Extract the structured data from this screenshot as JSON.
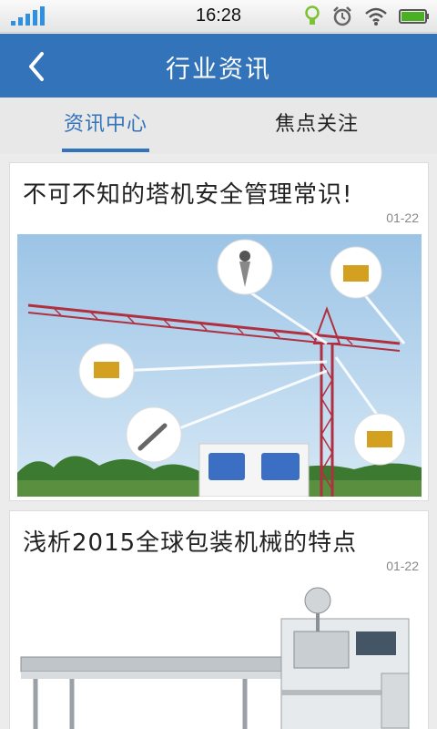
{
  "status": {
    "time": "16:28",
    "icons": [
      "signal-icon",
      "lightbulb-icon",
      "alarm-icon",
      "wifi-icon",
      "battery-icon"
    ]
  },
  "header": {
    "title": "行业资讯",
    "back_icon": "chevron-left-icon"
  },
  "tabs": [
    {
      "label": "资讯中心",
      "active": true
    },
    {
      "label": "焦点关注",
      "active": false
    }
  ],
  "articles": [
    {
      "title": "不可不知的塔机安全管理常识!",
      "date": "01-22",
      "image": "tower-crane-sensors"
    },
    {
      "title": "浅析2015全球包装机械的特点",
      "date": "01-22",
      "image": "packaging-machine"
    }
  ],
  "colors": {
    "primary": "#3273b9",
    "tab_background": "#e8e8e8",
    "page_background": "#ececec"
  }
}
